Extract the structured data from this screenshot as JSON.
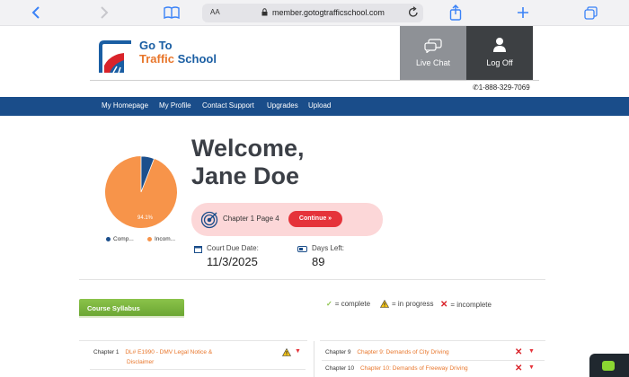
{
  "browser": {
    "text_size_label": "AA",
    "url": "member.gotogtrafficschool.com"
  },
  "header": {
    "logo_line1": "Go To",
    "logo_line2a": "Traffic",
    "logo_line2b": "School",
    "live_chat_label": "Live Chat",
    "log_off_label": "Log Off",
    "phone": "1-888-329-7069"
  },
  "nav": {
    "items": [
      "My Homepage",
      "My Profile",
      "Contact Support",
      "Upgrades",
      "Upload"
    ]
  },
  "progress_chart": {
    "complete_percent": 5.9,
    "incomplete_percent": 94.1,
    "incomplete_label": "94.1%",
    "legend_complete": "Comp...",
    "legend_incomplete": "Incom...",
    "complete_color": "#1c4f8c",
    "incomplete_color": "#f7944a"
  },
  "welcome": {
    "line1": "Welcome,",
    "line2": "Jane Doe"
  },
  "current": {
    "position": "Chapter 1 Page 4",
    "continue_label": "Continue »"
  },
  "due": {
    "court_label": "Court Due Date:",
    "court_value": "11/3/2025",
    "days_label": "Days Left:",
    "days_value": "89"
  },
  "syllabus": {
    "tab_label": "Course Syllabus",
    "key_complete": "= complete",
    "key_progress": "= in progress",
    "key_incomplete": "= incomplete",
    "left": [
      {
        "num": "Chapter 1",
        "title": "DL# E1990 - DMV Legal Notice &",
        "title2": "Disclaimer",
        "status": "in-progress"
      }
    ],
    "right": [
      {
        "num": "Chapter 9",
        "title": "Chapter 9: Demands of City Driving",
        "status": "incomplete"
      },
      {
        "num": "Chapter 10",
        "title": "Chapter 10: Demands of Freeway Driving",
        "status": "incomplete"
      }
    ]
  }
}
